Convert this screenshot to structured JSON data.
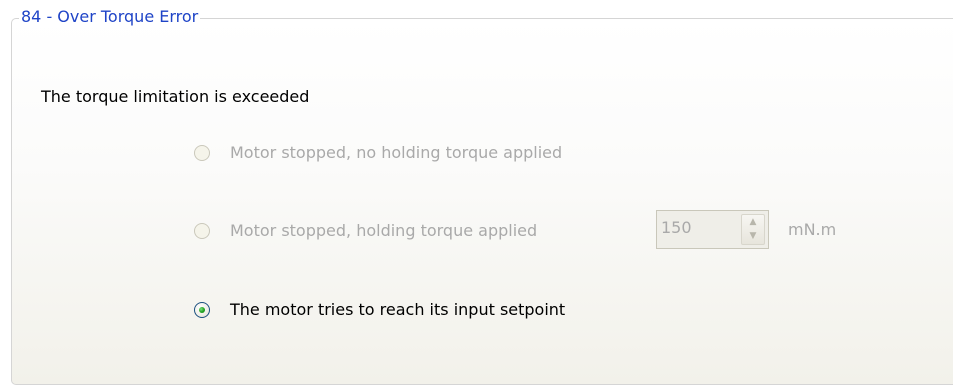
{
  "group": {
    "title": "84 - Over Torque Error",
    "description": "The torque limitation is exceeded",
    "options": [
      {
        "label": "Motor stopped, no holding torque applied",
        "selected": false,
        "enabled": false
      },
      {
        "label": "Motor stopped, holding torque applied",
        "selected": false,
        "enabled": false
      },
      {
        "label": "The motor tries to reach its input setpoint",
        "selected": true,
        "enabled": true
      }
    ],
    "holding_torque": {
      "value": "150",
      "unit": "mN.m",
      "enabled": false
    }
  },
  "colors": {
    "title": "#1f44c7",
    "disabled_text": "#a9a9a9",
    "radio_dot": "#21a121"
  },
  "icons": {
    "spin_up": "chevron-up-icon",
    "spin_down": "chevron-down-icon"
  }
}
